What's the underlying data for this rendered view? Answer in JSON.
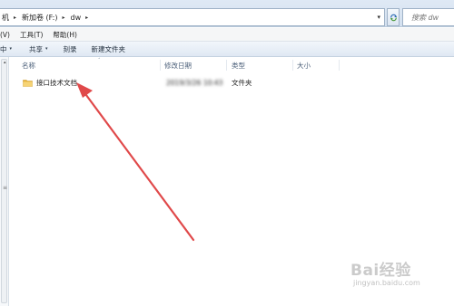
{
  "address_bar": {
    "crumbs": [
      "机",
      "新加卷 (F:)",
      "dw"
    ],
    "separator": "▸",
    "dropdown": "▾",
    "search_placeholder": "搜索 dw"
  },
  "menu": [
    "(V)",
    "工具(T)",
    "帮助(H)"
  ],
  "toolbar": {
    "items": [
      "中",
      "共享",
      "刻录",
      "新建文件夹"
    ],
    "dropdown": "▾"
  },
  "columns": [
    "名称",
    "修改日期",
    "类型",
    "大小"
  ],
  "sort_indicator": "˄",
  "files": [
    {
      "name": "接口技术文档",
      "modified": "2019/3/26 10:43",
      "type": "文件夹",
      "size": ""
    }
  ],
  "colors": {
    "annotation_arrow": "#e0494a",
    "folder_yellow": "#f1c75b"
  },
  "watermark": {
    "text": "Bai经验",
    "sub": "jingyan.baidu.com"
  }
}
